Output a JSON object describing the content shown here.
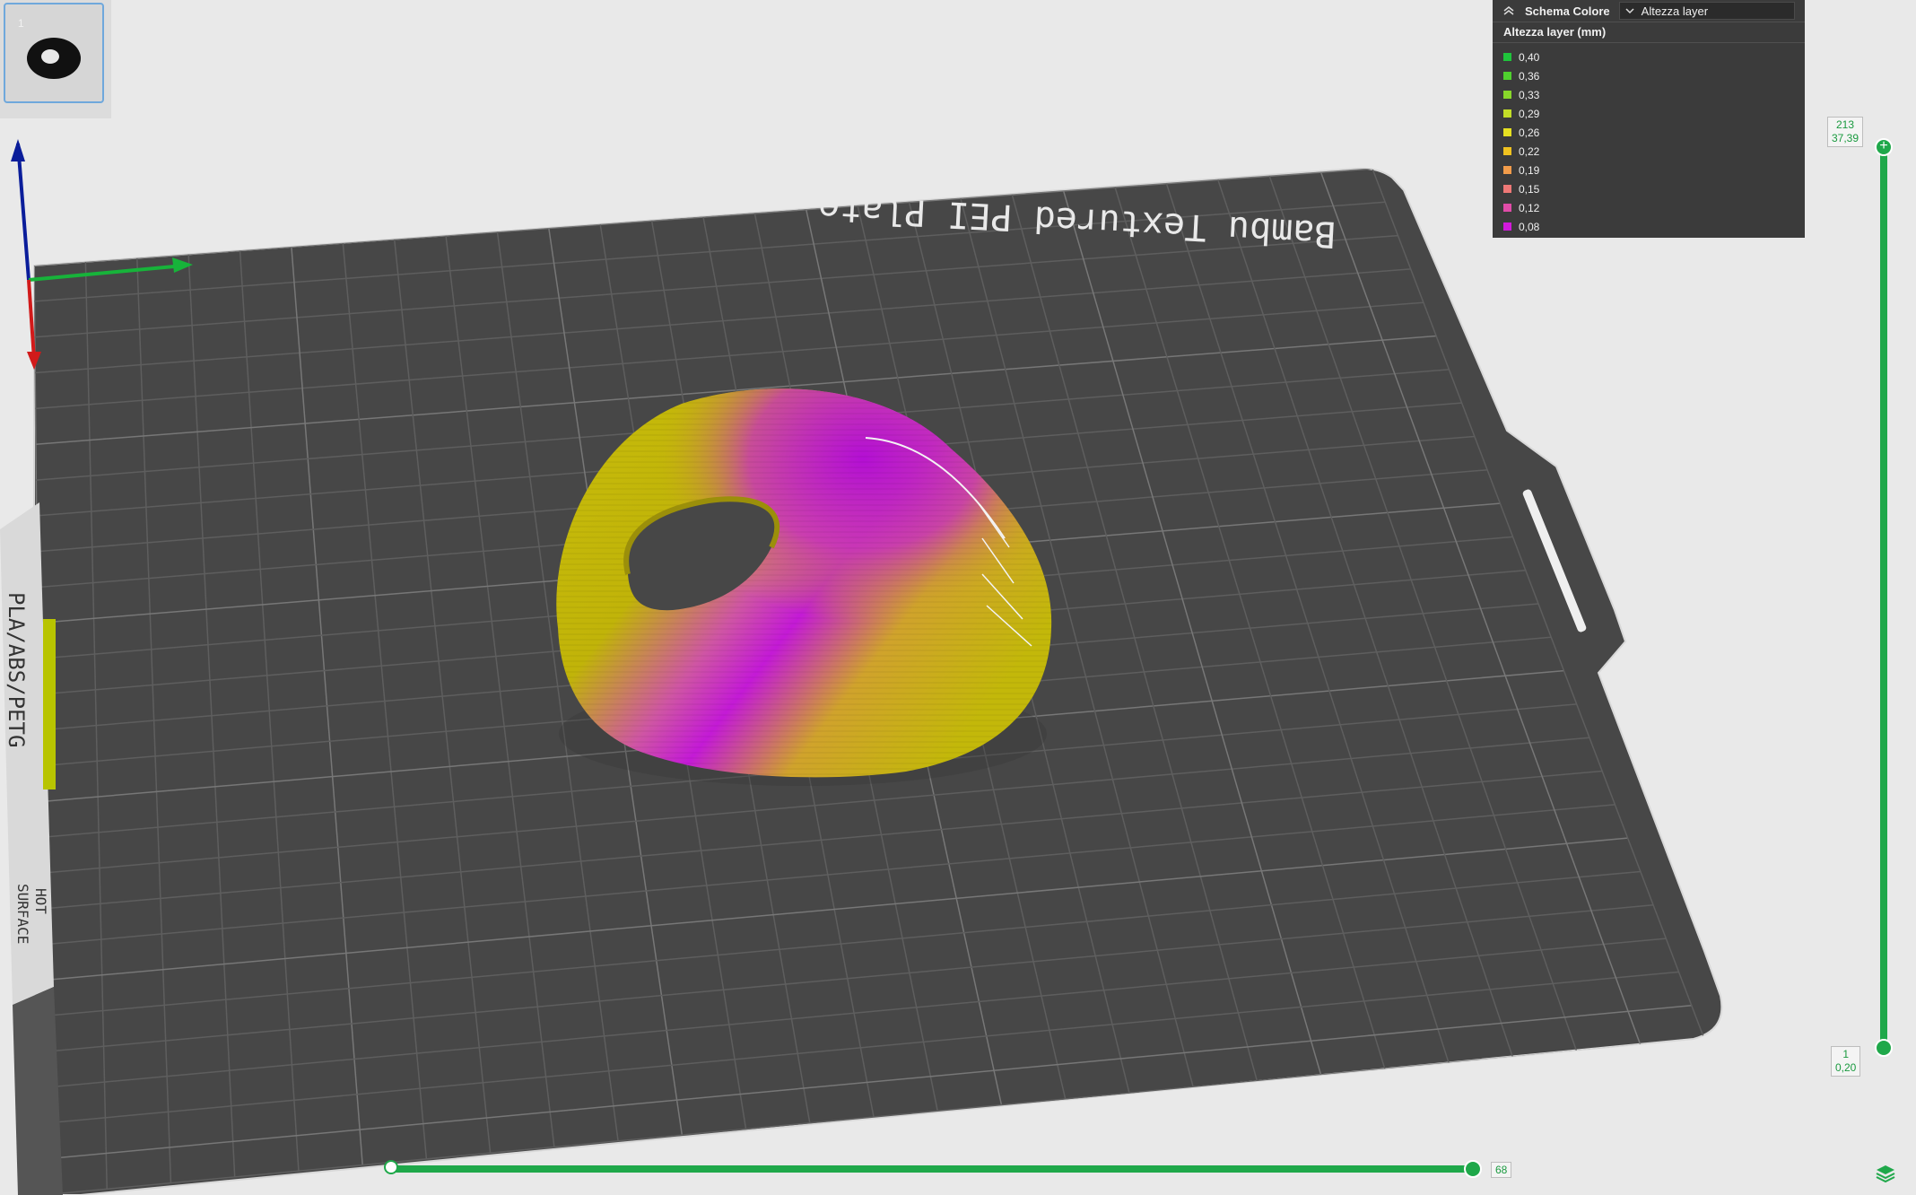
{
  "plate": {
    "label": "Bambu Textured PEI Plate"
  },
  "bed_sticker": {
    "material_text": "PLA/ABS/PETG",
    "warning_line1": "HOT",
    "warning_line2": "SURFACE"
  },
  "thumbnail": {
    "number": "1",
    "active": true
  },
  "legend": {
    "title": "Schema Colore",
    "selected_view": "Altezza layer",
    "subtitle": "Altezza layer (mm)",
    "items": [
      {
        "value": "0,40",
        "color": "#1fc43b"
      },
      {
        "value": "0,36",
        "color": "#4fd12e"
      },
      {
        "value": "0,33",
        "color": "#88d72a"
      },
      {
        "value": "0,29",
        "color": "#c2dd27"
      },
      {
        "value": "0,26",
        "color": "#e6e021"
      },
      {
        "value": "0,22",
        "color": "#f0c21f"
      },
      {
        "value": "0,19",
        "color": "#f29c4a"
      },
      {
        "value": "0,15",
        "color": "#ee7876"
      },
      {
        "value": "0,12",
        "color": "#e04ca8"
      },
      {
        "value": "0,08",
        "color": "#d21adb"
      }
    ]
  },
  "vertical_slider": {
    "top_layer": "213",
    "top_height": "37,39",
    "bottom_layer": "1",
    "bottom_height": "0,20"
  },
  "horizontal_slider": {
    "value": "68"
  },
  "colors": {
    "accent": "#1fa84a",
    "plate": "#474747",
    "grid": "#5e5e5e",
    "model_yellow": "#c5b800",
    "model_magenta": "#c41ad6"
  }
}
